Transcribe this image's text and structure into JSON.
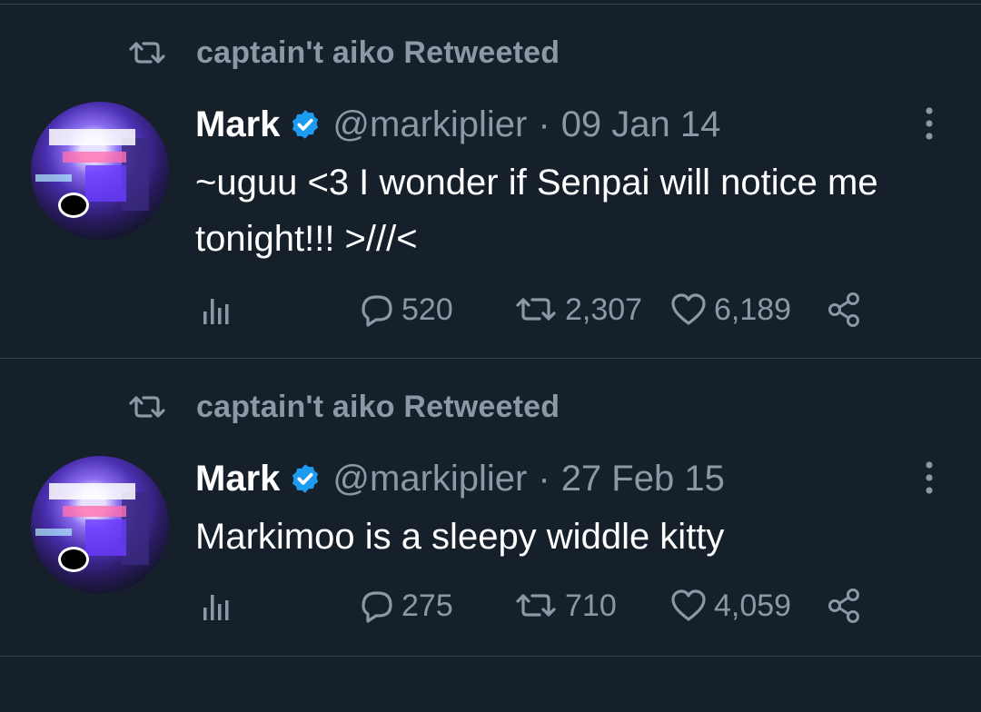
{
  "tweets": [
    {
      "retweeted_by": "captain't aiko Retweeted",
      "name": "Mark",
      "handle": "@markiplier",
      "separator": "·",
      "date": "09 Jan 14",
      "text": "~uguu <3 I wonder if Senpai will notice me tonight!!! >///<",
      "replies": "520",
      "retweets": "2,307",
      "likes": "6,189"
    },
    {
      "retweeted_by": "captain't aiko Retweeted",
      "name": "Mark",
      "handle": "@markiplier",
      "separator": "·",
      "date": "27 Feb 15",
      "text": "Markimoo is a sleepy widdle kitty",
      "replies": "275",
      "retweets": "710",
      "likes": "4,059"
    }
  ],
  "icons": {
    "retweet_indicator": "retweet-icon",
    "verified": "verified-badge-icon",
    "more": "more-options-icon",
    "analytics": "analytics-icon",
    "reply": "reply-icon",
    "retweet": "retweet-icon",
    "like": "heart-icon",
    "share": "share-icon"
  },
  "colors": {
    "background": "#15202b",
    "secondary_text": "#8b98a5",
    "verified_blue": "#1d9bf0",
    "divider": "#38444d"
  }
}
